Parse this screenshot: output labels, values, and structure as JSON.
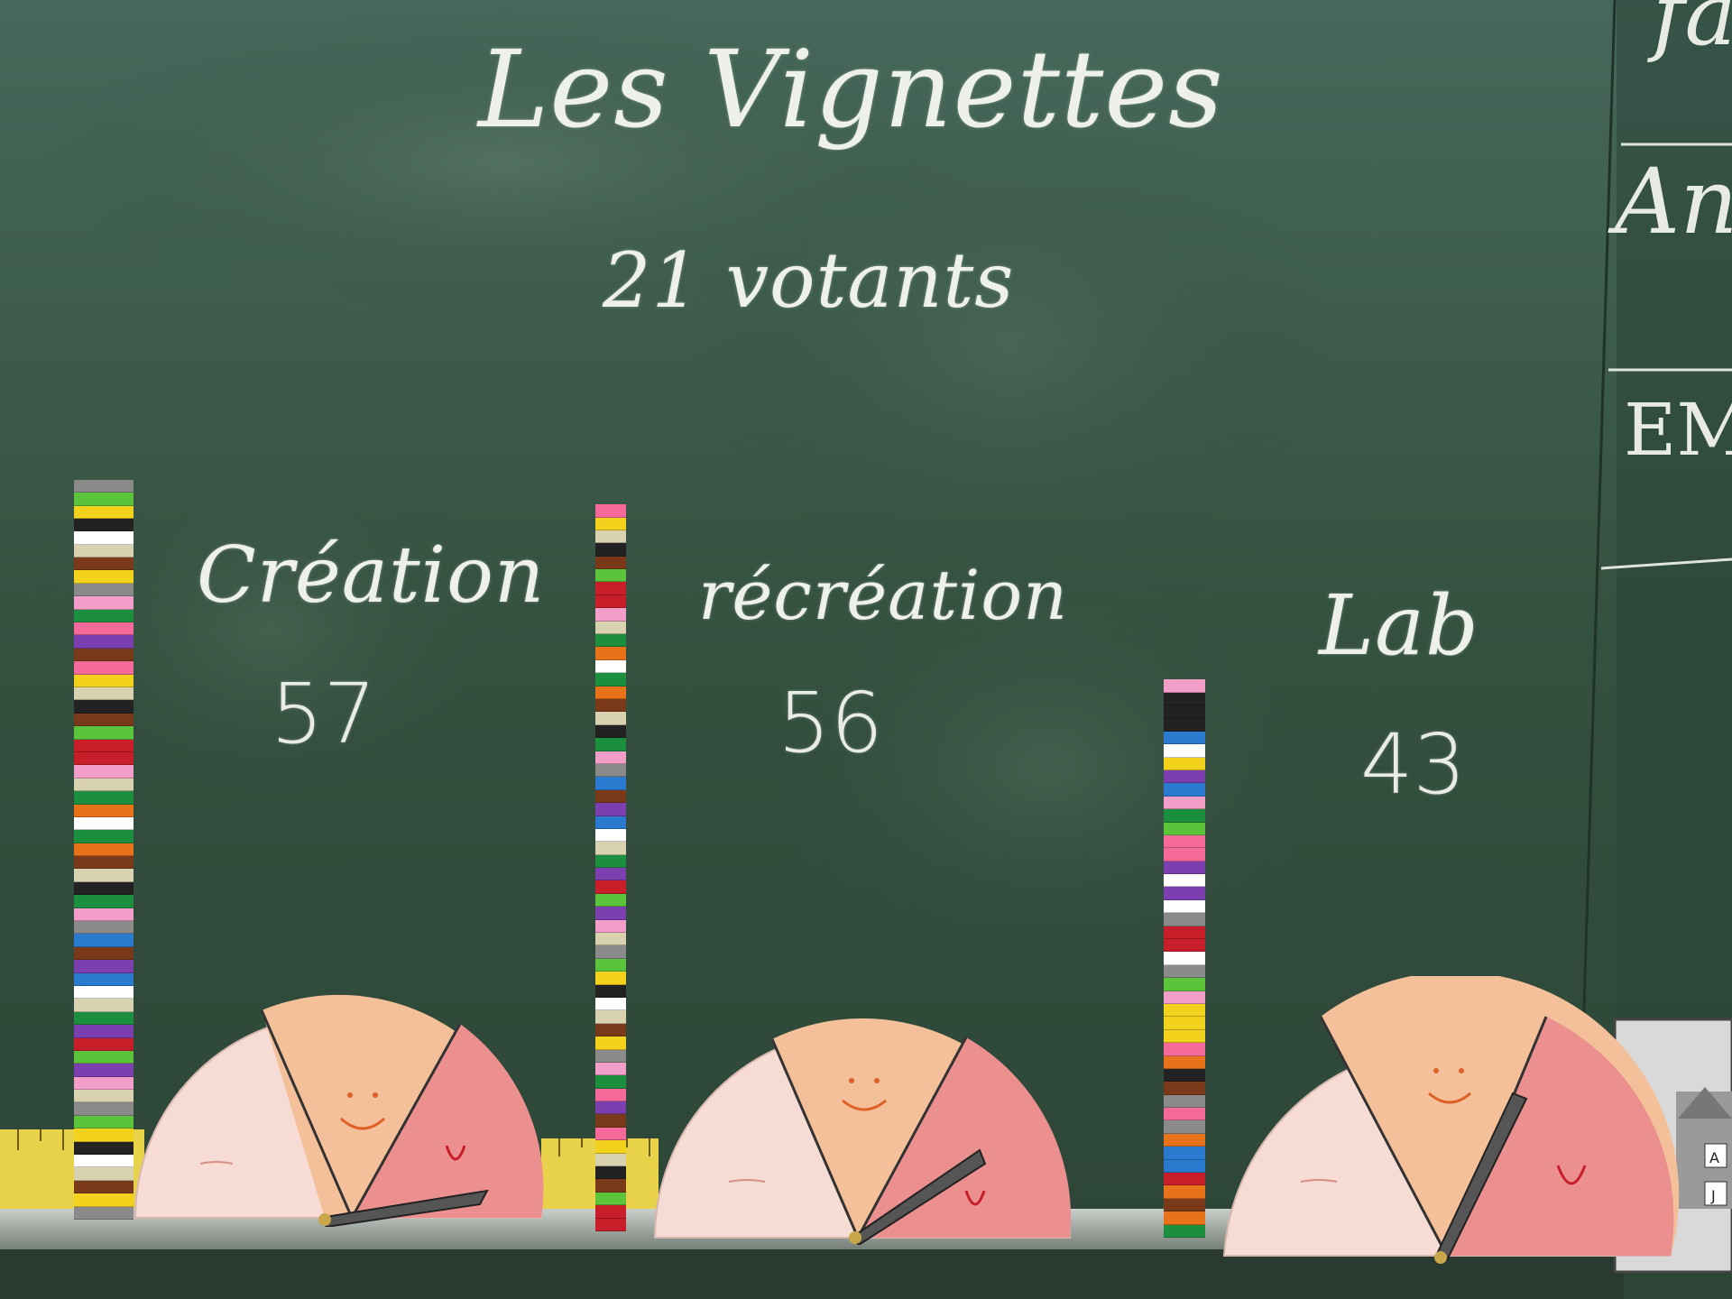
{
  "board": {
    "title": "Les Vignettes",
    "subtitle": "21 votants",
    "side_notes": [
      "fa",
      "An",
      "EM"
    ]
  },
  "votes": [
    {
      "name": "Création",
      "score": "57",
      "score_value": 57
    },
    {
      "name": "récréation",
      "score": "56",
      "score_value": 56
    },
    {
      "name": "Lab",
      "score": "43",
      "score_value": 43
    }
  ],
  "colors": {
    "board": "#2f4a3c",
    "chalk": "#eef0ea",
    "face_sad": "#f6dcd4",
    "face_happy": "#f3ab6a",
    "face_love": "#e9727b",
    "ruler": "#e8d24a",
    "tray": "#9aa49c"
  },
  "brick_palette": [
    "#f29ec8",
    "#2a7ad0",
    "#1c8f3e",
    "#f2d21c",
    "#e8721a",
    "#c81e2a",
    "#7a3a1a",
    "#d8d2b0",
    "#7b3fb0",
    "#5bc43b",
    "#ffffff",
    "#222222",
    "#8a8a8a",
    "#f56a9a"
  ]
}
